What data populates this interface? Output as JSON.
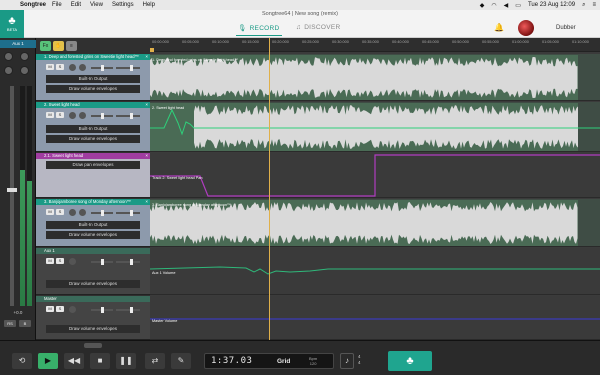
{
  "menubar": {
    "app_name": "Songtree",
    "items": [
      "File",
      "Edit",
      "View",
      "Settings",
      "Help"
    ],
    "datetime": "Tue 23 Aug  12:09"
  },
  "window": {
    "title": "Songtree64 | New song (remix)"
  },
  "logo": {
    "badge": "BETA"
  },
  "tabs": {
    "record": "RECORD",
    "discover": "DISCOVER"
  },
  "user": {
    "name": "Dubber"
  },
  "mixer": {
    "aux_label": "Aux 1",
    "volume_readout": "+0.0",
    "button_rs": "RS",
    "button_bypass": "B",
    "no_effects": "No Effects",
    "meter_level": 0.62
  },
  "toolbar": {
    "btn_fx": "Fx",
    "btn_hand": "✋",
    "btn_menu": "≡"
  },
  "tracks": [
    {
      "name": "1. Deep and forested grins on Sweetie light head™",
      "output": "Built-In Output",
      "envelope": "Draw volume envelopes",
      "mute": "M",
      "solo": "S"
    },
    {
      "name": "2. Sweet light head",
      "output": "Built-In Output",
      "envelope": "Draw volume envelopes",
      "mute": "M",
      "solo": "S"
    },
    {
      "name": "2.1. Sweet light head",
      "envelope": "Draw pan envelopes"
    },
    {
      "name": "3. Banjojamboree song of Monday afternoon™",
      "output": "Built-In Output",
      "envelope": "Draw volume envelopes",
      "mute": "M",
      "solo": "S"
    },
    {
      "name": "Aux 1",
      "envelope": "Draw volume envelopes",
      "mute": "M",
      "solo": "S"
    },
    {
      "name": "Master",
      "envelope": "Draw volume envelopes",
      "mute": "M",
      "solo": "S"
    }
  ],
  "lanes": {
    "clip1": "1. Deep and forested grins on Sweetie light head™",
    "clip2": "2. Sweet light head",
    "pan_label": "Track 2: Sweet light head Pan",
    "clip3": "3. Banjojamboree song of Monday afternoon™",
    "aux_label": "Aux 1 Volume",
    "master_label": "Master Volume"
  },
  "ruler": [
    "00:00.000",
    "00:05.000",
    "00:10.000",
    "00:15.000",
    "00:20.000",
    "00:25.000",
    "00:30.000",
    "00:35.000",
    "00:40.000",
    "00:45.000",
    "00:50.000",
    "00:55.000",
    "01:00.000",
    "01:05.000",
    "01:10.000"
  ],
  "transport": {
    "time": "1:37.03",
    "grid": "Grid",
    "bpm_label": "Bpm",
    "bpm_value": "120",
    "timesig_top": "4",
    "timesig_bottom": "4"
  },
  "colors": {
    "accent": "#1a9a86",
    "pan": "#b03cc0",
    "master": "#3b3bd8",
    "playhead": "#e0b04a"
  }
}
